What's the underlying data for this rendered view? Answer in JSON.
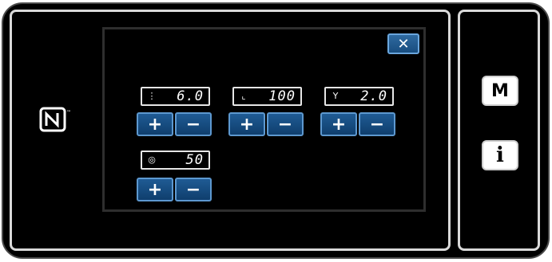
{
  "close_label": "✕",
  "params": [
    {
      "icon": "stitch-pitch-icon",
      "glyph": "⋮",
      "value": "6.0"
    },
    {
      "icon": "presser-foot-icon",
      "glyph": "⌞",
      "value": "100"
    },
    {
      "icon": "thread-tension-icon",
      "glyph": "Y",
      "value": "2.0"
    },
    {
      "icon": "bobbin-counter-icon",
      "glyph": "◎",
      "value": "50"
    }
  ],
  "plus_label": "+",
  "minus_label": "−",
  "side": {
    "mode_label": "M",
    "info_label": "i"
  },
  "nfc_label": "N"
}
